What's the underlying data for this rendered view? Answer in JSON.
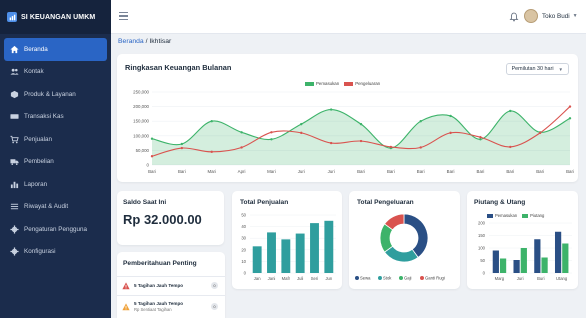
{
  "app": {
    "title": "SI KEUANGAN UMKM"
  },
  "sidebar": {
    "items": [
      {
        "label": "Beranda",
        "icon": "home-icon",
        "active": true
      },
      {
        "label": "Kontak",
        "icon": "users-icon"
      },
      {
        "label": "Produk & Layanan",
        "icon": "box-icon"
      },
      {
        "label": "Transaksi Kas",
        "icon": "cash-icon"
      },
      {
        "label": "Penjualan",
        "icon": "cart-icon"
      },
      {
        "label": "Pembelian",
        "icon": "truck-icon"
      },
      {
        "label": "Laporan",
        "icon": "bar-chart-icon"
      },
      {
        "label": "Riwayat & Audit",
        "icon": "list-icon"
      },
      {
        "label": "Pengaturan Pengguna",
        "icon": "gear-icon"
      },
      {
        "label": "Konfigurasi",
        "icon": "gear-icon"
      }
    ]
  },
  "topbar": {
    "user_name": "Toko Budi"
  },
  "breadcrumb": {
    "home": "Beranda",
    "separator": "/",
    "current": "Ikhtisar"
  },
  "colors": {
    "accent": "#2a65c5",
    "income": "#3db36a",
    "expense": "#d9534f",
    "sidebar": "#1b2c4c"
  },
  "monthly": {
    "title": "Ringkasan Keuangan Bulanan",
    "period": "Pemilutan 30 hari",
    "chart_data": {
      "type": "line",
      "categories": [
        "Bari",
        "Bari",
        "Mari",
        "Apri",
        "Mari",
        "Juri",
        "Juri",
        "Bari",
        "Bari",
        "Bari",
        "Bari",
        "Bari",
        "Bari",
        "Bari",
        "Bari"
      ],
      "ylim": [
        0,
        250000
      ],
      "yticks": [
        "250,000",
        "200,000",
        "150,000",
        "100,000",
        "50,000",
        "0"
      ],
      "series": [
        {
          "name": "Pemasukan",
          "values": [
            90000,
            72000,
            150000,
            112000,
            88000,
            140000,
            190000,
            140000,
            58000,
            150000,
            168000,
            88000,
            185000,
            112000,
            160000
          ]
        },
        {
          "name": "Pengeluaran",
          "values": [
            30000,
            58000,
            45000,
            60000,
            112000,
            110000,
            75000,
            82000,
            62000,
            60000,
            110000,
            95000,
            62000,
            110000,
            200000
          ]
        }
      ]
    }
  },
  "balance": {
    "title": "Saldo Saat Ini",
    "amount": "Rp 32.000.00"
  },
  "notifications": {
    "title": "Pemberitahuan Penting",
    "items": [
      {
        "text": "5 Tagihan Jauh Tempo",
        "count": "0"
      },
      {
        "text": "5 Tagihan Jauh Tempo",
        "sub": "Rp Sentiaat Tagihan",
        "count": "0"
      }
    ]
  },
  "sales": {
    "title": "Total Penjualan",
    "chart_data": {
      "type": "bar",
      "categories": [
        "Jan",
        "Jani",
        "Mafr",
        "Juli",
        "Seri",
        "Jun"
      ],
      "values": [
        23,
        35,
        29,
        34,
        43,
        45
      ],
      "ylim": [
        0,
        50
      ],
      "yticks": [
        "50",
        "40",
        "30",
        "20",
        "10",
        "0"
      ]
    }
  },
  "expenses": {
    "title": "Total Pengeluaran",
    "chart_data": {
      "type": "pie",
      "labels": [
        "Sewa",
        "Stok",
        "Gaji",
        "Ganti Rugi"
      ],
      "values": [
        40,
        25,
        20,
        15
      ],
      "colors": [
        "#2a4f85",
        "#2f9e9e",
        "#3db36a",
        "#d9534f"
      ]
    }
  },
  "receivables": {
    "title": "Piutang & Utang",
    "chart_data": {
      "type": "bar",
      "categories": [
        "Marg",
        "Juri",
        "Buri",
        "Utang"
      ],
      "ylim": [
        0,
        200
      ],
      "yticks": [
        "200",
        "150",
        "100",
        "50",
        "0"
      ],
      "series": [
        {
          "name": "Pemasukan",
          "values": [
            90,
            52,
            135,
            165
          ]
        },
        {
          "name": "Piutang",
          "values": [
            58,
            100,
            62,
            118
          ]
        }
      ]
    }
  }
}
